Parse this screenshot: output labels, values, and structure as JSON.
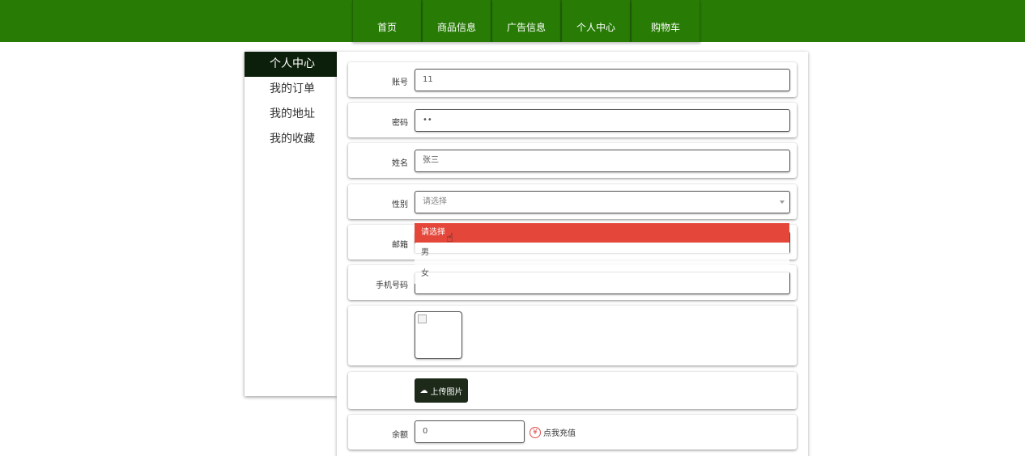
{
  "nav": {
    "items": [
      {
        "label": "首页"
      },
      {
        "label": "商品信息"
      },
      {
        "label": "广告信息"
      },
      {
        "label": "个人中心"
      },
      {
        "label": "购物车"
      }
    ]
  },
  "sidebar": {
    "items": [
      {
        "label": "个人中心",
        "active": true
      },
      {
        "label": "我的订单"
      },
      {
        "label": "我的地址"
      },
      {
        "label": "我的收藏"
      }
    ]
  },
  "form": {
    "account": {
      "label": "账号",
      "value": "11"
    },
    "password": {
      "label": "密码",
      "value": "••"
    },
    "name": {
      "label": "姓名",
      "value": "张三"
    },
    "gender": {
      "label": "性别",
      "selected": "请选择",
      "options": [
        "请选择",
        "男",
        "女"
      ]
    },
    "email": {
      "label": "邮箱"
    },
    "phone": {
      "label": "手机号码"
    },
    "upload": {
      "label": "上传图片"
    },
    "balance": {
      "label": "余额",
      "value": "0",
      "recharge_label": "点我充值"
    }
  },
  "colors": {
    "nav_bg": "#287c06",
    "sidebar_active_bg": "#0c1f0a",
    "option_highlight": "#e5463a",
    "upload_button": "#1d2a1a"
  }
}
